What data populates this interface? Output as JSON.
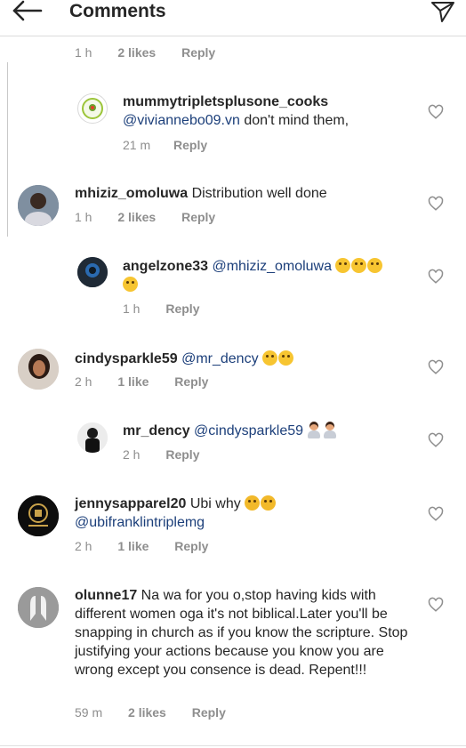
{
  "header": {
    "title": "Comments"
  },
  "top_meta": {
    "time": "1 h",
    "likes": "2 likes",
    "reply": "Reply"
  },
  "comments": [
    {
      "username": "mummytripletsplusone_cooks",
      "mention": "@viviannebo09.vn",
      "text": " don't mind them,",
      "time": "21 m",
      "reply": "Reply"
    },
    {
      "username": "mhiziz_omoluwa",
      "text": " Distribution well done",
      "time": "1 h",
      "likes": "2 likes",
      "reply": "Reply"
    },
    {
      "username": "angelzone33",
      "mention": "@mhiziz_omoluwa",
      "time": "1 h",
      "reply": "Reply"
    },
    {
      "username": "cindysparkle59",
      "mention": "@mr_dency",
      "time": "2 h",
      "likes": "1 like",
      "reply": "Reply"
    },
    {
      "username": "mr_dency",
      "mention": "@cindysparkle59",
      "time": "2 h",
      "reply": "Reply"
    },
    {
      "username": "jennysapparel20",
      "text": " Ubi why",
      "mention": "@ubifranklintriplemg",
      "time": "2 h",
      "likes": "1 like",
      "reply": "Reply"
    },
    {
      "username": "olunne17",
      "text": " Na wa for you o,stop having kids with different women oga it's not biblical.Later you'll be snapping in church as if you know the scripture. Stop justifying your actions because you know you are wrong except you consence is dead. Repent!!!",
      "time": "59 m",
      "likes": "2 likes",
      "reply": "Reply"
    }
  ],
  "colors": {
    "mention": "#1c3f7a",
    "meta": "#8e8e8e",
    "text": "#262626"
  },
  "icons": {
    "back": "arrow-left-icon",
    "send": "paper-plane-icon",
    "like": "heart-outline-icon"
  }
}
